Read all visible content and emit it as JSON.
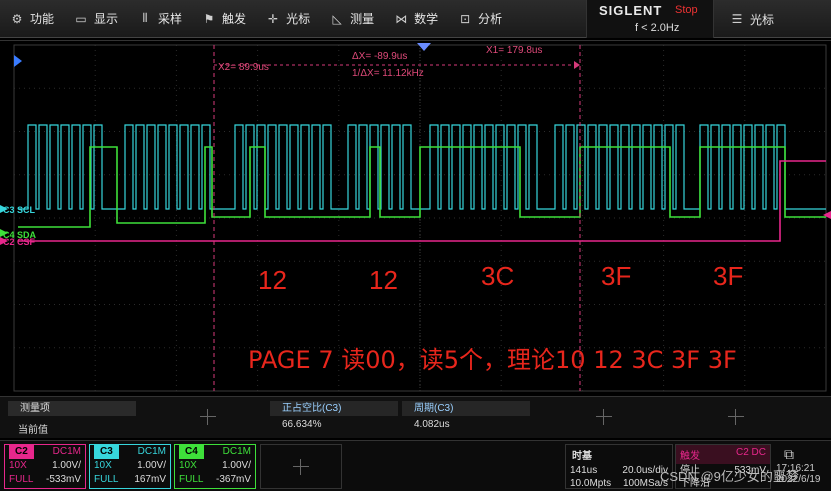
{
  "menu": {
    "items": [
      {
        "icon": "gear-icon",
        "glyph": "⚙",
        "label": "功能"
      },
      {
        "icon": "display-icon",
        "glyph": "▭",
        "label": "显示"
      },
      {
        "icon": "acquire-icon",
        "glyph": "⫴",
        "label": "采样"
      },
      {
        "icon": "trigger-icon",
        "glyph": "⚑",
        "label": "触发"
      },
      {
        "icon": "cursor-icon",
        "glyph": "✛",
        "label": "光标"
      },
      {
        "icon": "measure-icon",
        "glyph": "◺",
        "label": "测量"
      },
      {
        "icon": "math-icon",
        "glyph": "⋈",
        "label": "数学"
      },
      {
        "icon": "analysis-icon",
        "glyph": "⊡",
        "label": "分析"
      }
    ],
    "brand": "SIGLENT",
    "run_status": "Stop",
    "frequency": "f < 2.0Hz",
    "cursor_menu": {
      "icon": "list-icon",
      "glyph": "☰",
      "label": "光标"
    }
  },
  "cursors": {
    "x2": "X2= 89.9us",
    "x1": "X1= 179.8us",
    "delta_x": "ΔX= -89.9us",
    "inv_delta_x": "1/ΔX= 11.12kHz"
  },
  "channels_on_screen": {
    "scl": "C3 SCL",
    "sda": "C4 SDA",
    "csf": "C2 CSF"
  },
  "annotations": {
    "bytes": [
      "12",
      "12",
      "3C",
      "3F",
      "3F"
    ],
    "note": "PAGE 7 读00，读5个，理论10 12 3C 3F 3F"
  },
  "measure": {
    "title": "测量项",
    "current": "当前值",
    "items": [
      {
        "name": "正占空比(C3)",
        "value": "66.634%"
      },
      {
        "name": "周期(C3)",
        "value": "4.082us"
      }
    ]
  },
  "channels": [
    {
      "id": "C2",
      "color": "#e8278c",
      "coupling": "DC1M",
      "probe": "10X",
      "scale": "1.00V/",
      "bw": "FULL",
      "offset": "-533mV"
    },
    {
      "id": "C3",
      "color": "#37d6dc",
      "coupling": "DC1M",
      "probe": "10X",
      "scale": "1.00V/",
      "bw": "FULL",
      "offset": "167mV"
    },
    {
      "id": "C4",
      "color": "#3ee03a",
      "coupling": "DC1M",
      "probe": "10X",
      "scale": "1.00V/",
      "bw": "FULL",
      "offset": "-367mV"
    }
  ],
  "timebase": {
    "label": "时基",
    "delay": "141us",
    "scale": "20.0us/div",
    "memory": "10.0Mpts",
    "rate": "100MSa/s"
  },
  "trigger": {
    "label": "触发",
    "source": "C2 DC",
    "mode": "停止",
    "level": "533mV",
    "slope": "下降沿"
  },
  "clock": "17:16:21",
  "date": "2022/6/19",
  "watermark": "CSDN @9亿少女的噩梦",
  "colors": {
    "scl": "#37d6dc",
    "sda": "#3ee03a",
    "csf": "#e8278c",
    "cursor": "#d63a7a",
    "annot": "#e8261c"
  }
}
